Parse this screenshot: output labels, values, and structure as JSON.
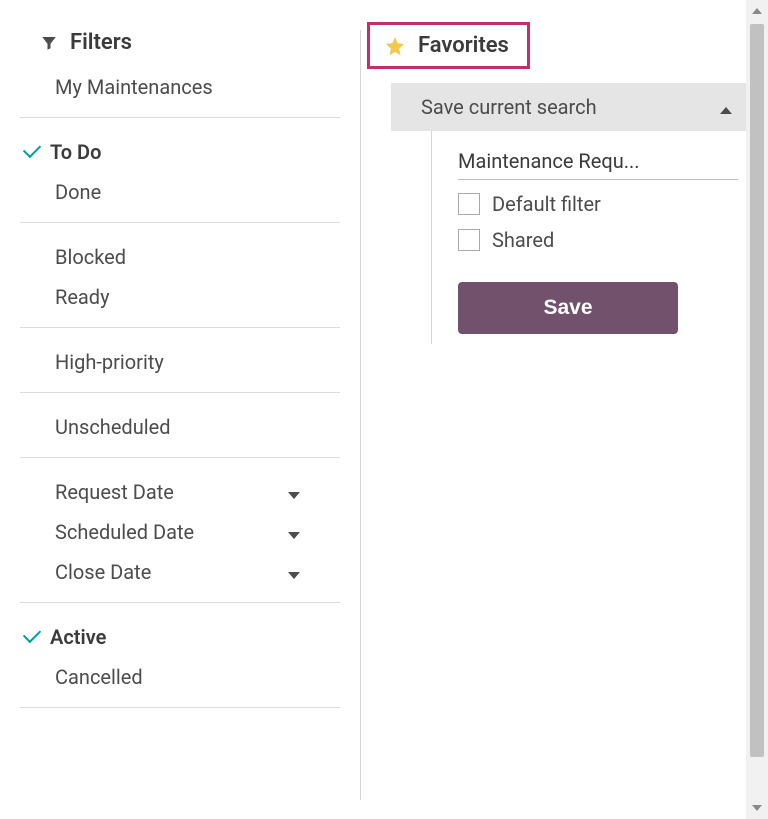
{
  "filters": {
    "header": "Filters",
    "groups": [
      {
        "items": [
          {
            "label": "My Maintenances",
            "checked": false
          }
        ]
      },
      {
        "items": [
          {
            "label": "To Do",
            "checked": true,
            "bold": true
          },
          {
            "label": "Done",
            "checked": false
          }
        ]
      },
      {
        "items": [
          {
            "label": "Blocked",
            "checked": false
          },
          {
            "label": "Ready",
            "checked": false
          }
        ]
      },
      {
        "items": [
          {
            "label": "High-priority",
            "checked": false
          }
        ]
      },
      {
        "items": [
          {
            "label": "Unscheduled",
            "checked": false
          }
        ]
      },
      {
        "items": [
          {
            "label": "Request Date",
            "checked": false,
            "caret": true
          },
          {
            "label": "Scheduled Date",
            "checked": false,
            "caret": true
          },
          {
            "label": "Close Date",
            "checked": false,
            "caret": true
          }
        ]
      },
      {
        "items": [
          {
            "label": "Active",
            "checked": true,
            "bold": true
          },
          {
            "label": "Cancelled",
            "checked": false
          }
        ]
      }
    ]
  },
  "favorites": {
    "header": "Favorites",
    "save_current_search": "Save current search",
    "search_name": "Maintenance Requ...",
    "default_filter_label": "Default filter",
    "shared_label": "Shared",
    "save_label": "Save"
  }
}
